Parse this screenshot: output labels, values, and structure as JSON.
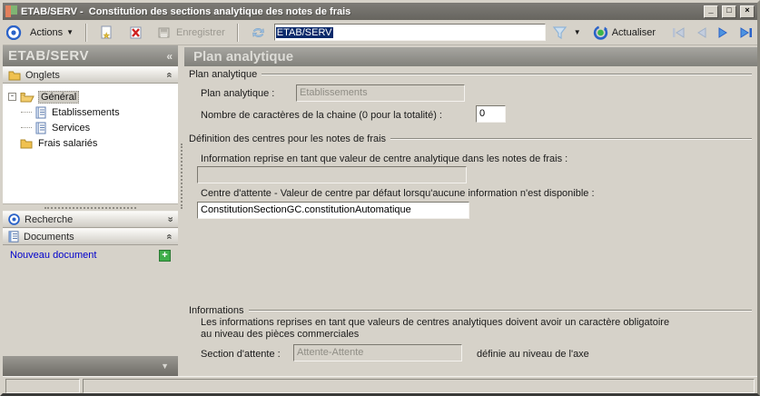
{
  "window": {
    "title": "ETAB/SERV -  Constitution des sections analytique des notes de frais",
    "minimize_glyph": "_",
    "maximize_glyph": "□",
    "close_glyph": "×"
  },
  "toolbar": {
    "actions_label": "Actions",
    "enregistrer_label": "Enregistrer",
    "combo_value": "ETAB/SERV",
    "actualiser_label": "Actualiser"
  },
  "sidebar": {
    "header": "ETAB/SERV",
    "collapse_glyph": "«",
    "panels": {
      "onglets": "Onglets",
      "recherche": "Recherche",
      "documents": "Documents"
    },
    "tree": [
      {
        "label": "Général"
      },
      {
        "label": "Etablissements"
      },
      {
        "label": "Services"
      },
      {
        "label": "Frais salariés"
      }
    ],
    "nouveau_document": "Nouveau document"
  },
  "main": {
    "header": "Plan analytique",
    "group_plan": {
      "legend": "Plan analytique",
      "plan_label": "Plan analytique :",
      "plan_value": "Etablissements",
      "nb_label": "Nombre de caractères de la chaine (0 pour la totalité) :",
      "nb_value": "0"
    },
    "group_centres": {
      "legend": "Définition des centres pour les notes de frais",
      "info_label": "Information reprise en tant que valeur de centre analytique dans les notes de frais :",
      "info_value": "",
      "centre_label": "Centre d'attente - Valeur de centre par défaut lorsqu'aucune information n'est disponible :",
      "centre_value": "ConstitutionSectionGC.constitutionAutomatique"
    },
    "group_informations": {
      "legend": "Informations",
      "note_line1": "Les informations reprises en tant que valeurs de centres analytiques doivent avoir un caractère obligatoire",
      "note_line2": "au niveau des pièces commerciales",
      "section_label": "Section d'attente :",
      "section_value": "Attente-Attente",
      "section_suffix": "définie au niveau de l'axe"
    }
  }
}
